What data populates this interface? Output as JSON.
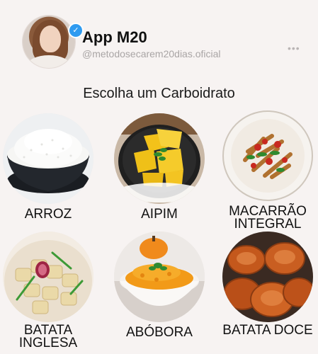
{
  "profile": {
    "app_title": "App M20",
    "handle": "@metodosecarem20dias.oficial",
    "more_label": "•••"
  },
  "section_title": "Escolha um Carboidrato",
  "options": [
    {
      "label": "ARROZ"
    },
    {
      "label": "AIPIM"
    },
    {
      "label": "MACARRÃO INTEGRAL"
    },
    {
      "label": "BATATA INGLESA"
    },
    {
      "label": "ABÓBORA"
    },
    {
      "label": "BATATA DOCE"
    }
  ]
}
